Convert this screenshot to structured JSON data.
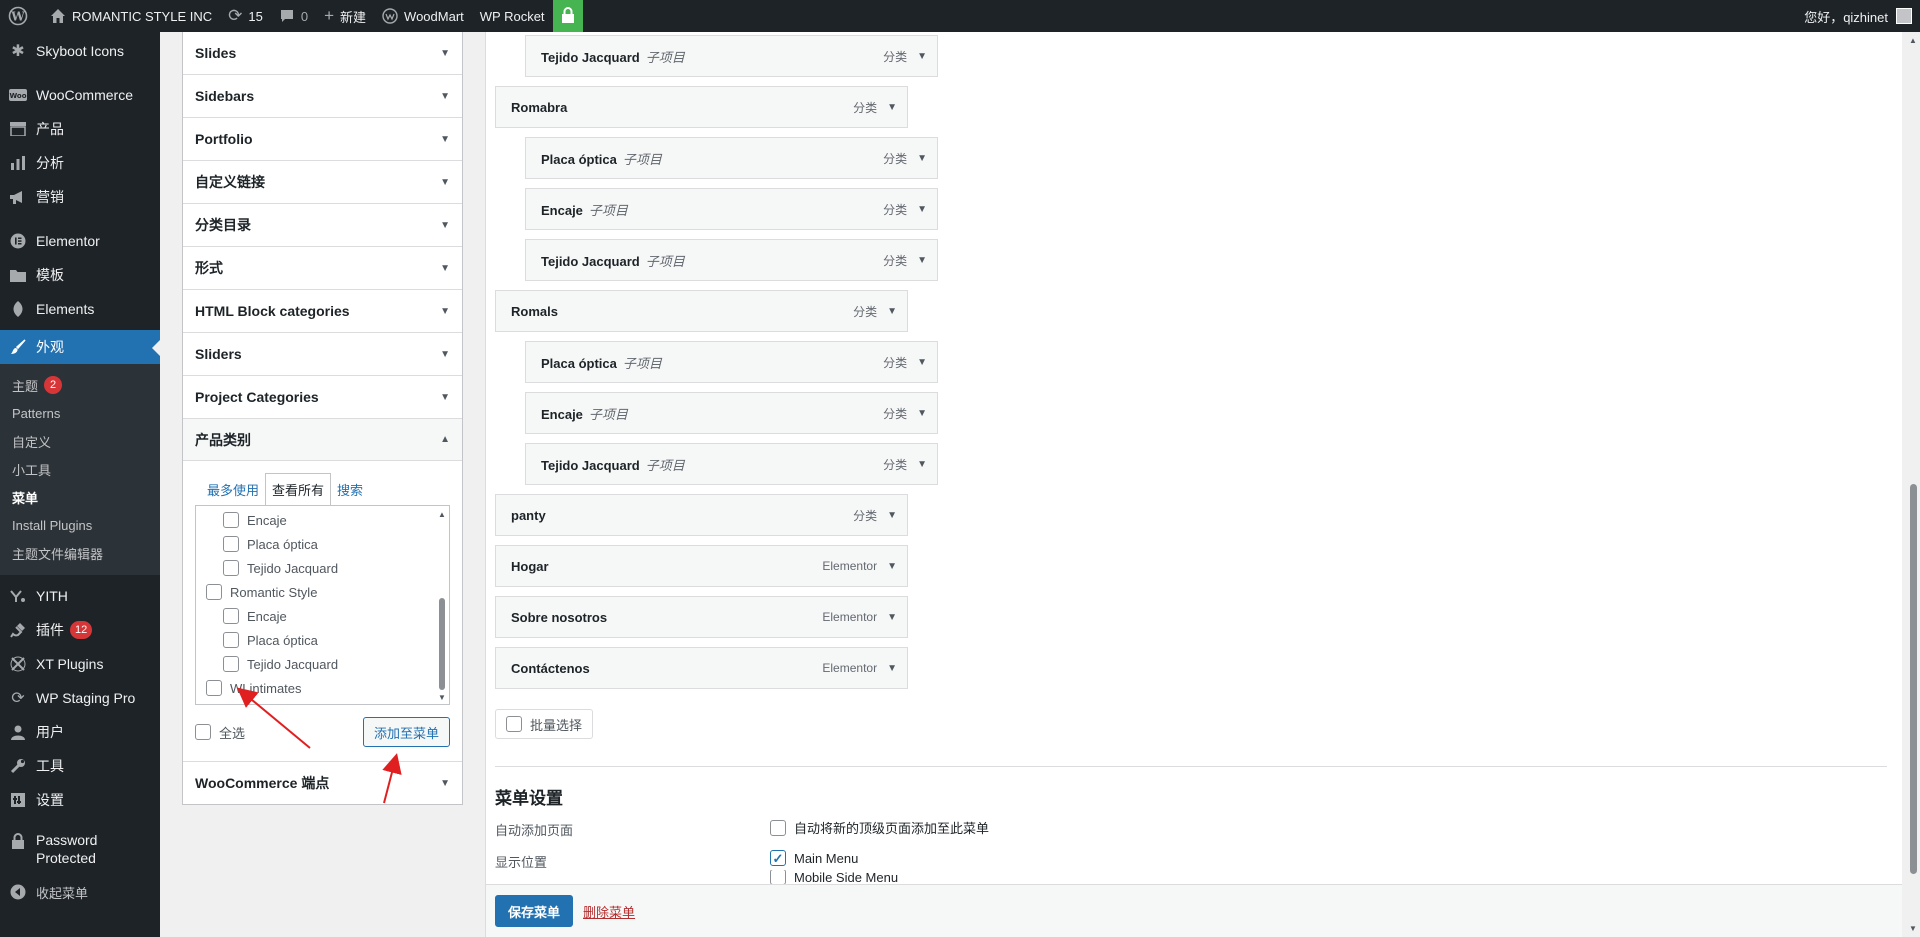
{
  "admin_bar": {
    "site_name": "ROMANTIC STYLE INC",
    "updates_count": "15",
    "comments_count": "0",
    "new_label": "新建",
    "woodmart_label": "WoodMart",
    "wprocket_label": "WP Rocket",
    "greeting": "您好，qizhinet"
  },
  "sidebar": {
    "items": [
      {
        "label": "Skyboot Icons",
        "icon": "star-icon"
      },
      {
        "label": "WooCommerce",
        "icon": "woocommerce-icon"
      },
      {
        "label": "产品",
        "icon": "archive-icon"
      },
      {
        "label": "分析",
        "icon": "bar-chart-icon"
      },
      {
        "label": "营销",
        "icon": "megaphone-icon"
      },
      {
        "label": "Elementor",
        "icon": "elementor-icon"
      },
      {
        "label": "模板",
        "icon": "folder-icon"
      },
      {
        "label": "Elements",
        "icon": "leaf-icon"
      },
      {
        "label": "外观",
        "icon": "paintbrush-icon"
      }
    ],
    "appearance_sub": [
      {
        "label": "主题",
        "badge": "2"
      },
      {
        "label": "Patterns"
      },
      {
        "label": "自定义"
      },
      {
        "label": "小工具"
      },
      {
        "label": "菜单"
      },
      {
        "label": "Install Plugins"
      },
      {
        "label": "主题文件编辑器"
      }
    ],
    "items_after": [
      {
        "label": "YITH",
        "icon": "yith-icon"
      },
      {
        "label": "插件",
        "icon": "plugin-icon",
        "badge": "12"
      },
      {
        "label": "XT Plugins",
        "icon": "xt-icon"
      },
      {
        "label": "WP Staging Pro",
        "icon": "refresh-icon"
      },
      {
        "label": "用户",
        "icon": "user-icon"
      },
      {
        "label": "工具",
        "icon": "wrench-icon"
      },
      {
        "label": "设置",
        "icon": "settings-icon"
      }
    ],
    "password_protected": "Password Protected",
    "collapse": "收起菜单"
  },
  "accordion": {
    "sections": [
      "Slides",
      "Sidebars",
      "Portfolio",
      "自定义链接",
      "分类目录",
      "形式",
      "HTML Block categories",
      "Sliders",
      "Project Categories"
    ],
    "open_section": "产品类别",
    "tabs": [
      "最多使用",
      "查看所有",
      "搜索"
    ],
    "active_tab": "查看所有",
    "categories": [
      {
        "label": "Encaje",
        "child": true
      },
      {
        "label": "Placa óptica",
        "child": true
      },
      {
        "label": "Tejido Jacquard",
        "child": true
      },
      {
        "label": "Romantic Style",
        "child": false
      },
      {
        "label": "Encaje",
        "child": true
      },
      {
        "label": "Placa óptica",
        "child": true
      },
      {
        "label": "Tejido Jacquard",
        "child": true
      },
      {
        "label": "WLintimates",
        "child": false
      }
    ],
    "select_all": "全选",
    "add_button": "添加至菜单",
    "last_section": "WooCommerce 端点"
  },
  "menu_items": [
    {
      "title": "Tejido Jacquard",
      "sub": "子项目",
      "type": "分类",
      "depth": 1
    },
    {
      "title": "Romabra",
      "sub": "",
      "type": "分类",
      "depth": 0
    },
    {
      "title": "Placa óptica",
      "sub": "子项目",
      "type": "分类",
      "depth": 1
    },
    {
      "title": "Encaje",
      "sub": "子项目",
      "type": "分类",
      "depth": 1
    },
    {
      "title": "Tejido Jacquard",
      "sub": "子项目",
      "type": "分类",
      "depth": 1
    },
    {
      "title": "Romals",
      "sub": "",
      "type": "分类",
      "depth": 0
    },
    {
      "title": "Placa óptica",
      "sub": "子项目",
      "type": "分类",
      "depth": 1
    },
    {
      "title": "Encaje",
      "sub": "子项目",
      "type": "分类",
      "depth": 1
    },
    {
      "title": "Tejido Jacquard",
      "sub": "子项目",
      "type": "分类",
      "depth": 1
    },
    {
      "title": "panty",
      "sub": "",
      "type": "分类",
      "depth": 0
    },
    {
      "title": "Hogar",
      "sub": "",
      "type": "Elementor",
      "depth": 0
    },
    {
      "title": "Sobre nosotros",
      "sub": "",
      "type": "Elementor",
      "depth": 0
    },
    {
      "title": "Contáctenos",
      "sub": "",
      "type": "Elementor",
      "depth": 0
    }
  ],
  "bulk_select": "批量选择",
  "settings": {
    "title": "菜单设置",
    "auto_add_label": "自动添加页面",
    "auto_add_option": "自动将新的顶级页面添加至此菜单",
    "location_label": "显示位置",
    "locations": [
      {
        "label": "Main Menu",
        "checked": true
      },
      {
        "label": "Mobile Side Menu",
        "checked": false
      }
    ]
  },
  "footer": {
    "save": "保存菜单",
    "delete": "删除菜单"
  }
}
